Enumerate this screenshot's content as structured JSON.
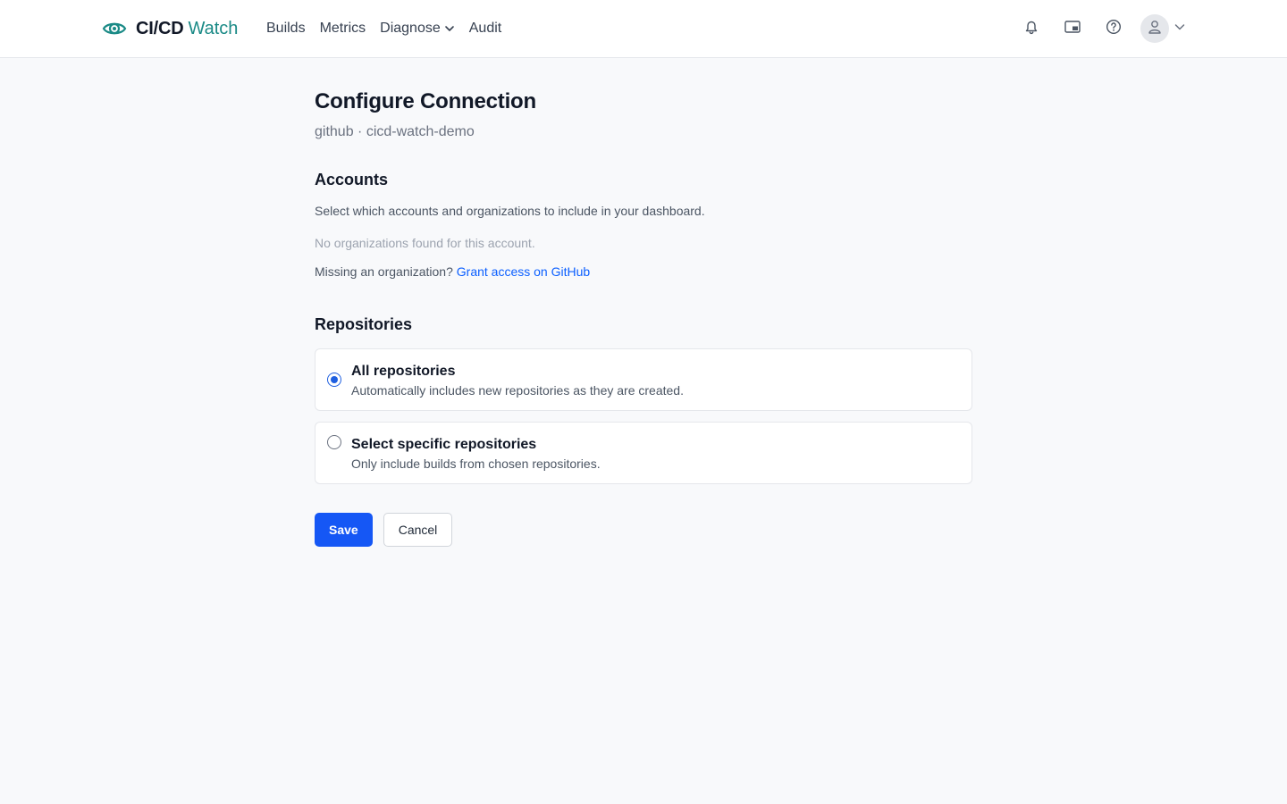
{
  "brand": {
    "name": "CI/CD",
    "accent": "Watch",
    "icon": "eye-icon",
    "color": "#1a8a86"
  },
  "nav": [
    {
      "label": "Builds"
    },
    {
      "label": "Metrics"
    },
    {
      "label": "Diagnose",
      "icon": "chevron-down-icon"
    },
    {
      "label": "Audit"
    }
  ],
  "header_icons": [
    "bell-icon",
    "picture-in-picture-icon",
    "help-circle-icon",
    "user-icon",
    "chevron-down-icon"
  ],
  "page": {
    "title": "Configure Connection",
    "subtitle": "github · cicd-watch-demo"
  },
  "accounts": {
    "title": "Accounts",
    "description": "Select which accounts and organizations to include in your dashboard.",
    "empty": "No organizations found for this account.",
    "missing_prefix": "Missing an organization?",
    "grant_link": "Grant access on GitHub"
  },
  "repositories": {
    "title": "Repositories",
    "options": [
      {
        "title": "All repositories",
        "description": "Automatically includes new repositories as they are created.",
        "selected": true
      },
      {
        "title": "Select specific repositories",
        "description": "Only include builds from chosen repositories.",
        "selected": false
      }
    ]
  },
  "actions": {
    "save": "Save",
    "cancel": "Cancel"
  },
  "colors": {
    "primary": "#1557f5",
    "link": "#0b5fff",
    "accent": "#1a8a86"
  }
}
